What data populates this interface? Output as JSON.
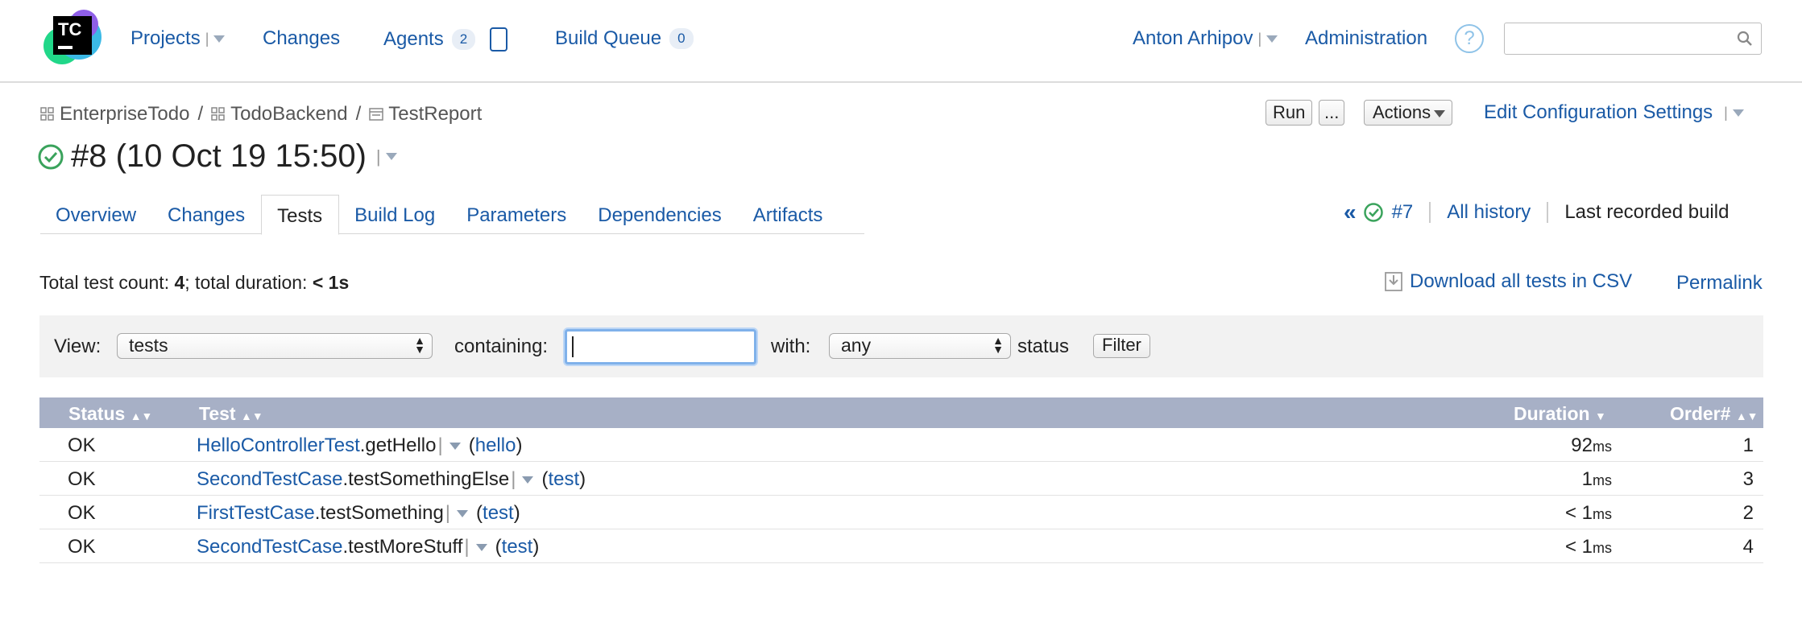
{
  "logo": {
    "text": "TC"
  },
  "nav": {
    "projects": "Projects",
    "changes": "Changes",
    "agents": "Agents",
    "agents_count": "2",
    "build_queue": "Build Queue",
    "build_queue_count": "0"
  },
  "user": {
    "name": "Anton Arhipov",
    "administration": "Administration",
    "help": "?"
  },
  "search": {
    "placeholder": ""
  },
  "breadcrumb": {
    "project": "EnterpriseTodo",
    "subproject": "TodoBackend",
    "config": "TestReport",
    "sep": "/"
  },
  "actions": {
    "run": "Run",
    "more": "...",
    "actions": "Actions",
    "edit": "Edit Configuration Settings"
  },
  "build": {
    "title": "#8 (10 Oct 19 15:50)"
  },
  "tabs": [
    {
      "label": "Overview"
    },
    {
      "label": "Changes"
    },
    {
      "label": "Tests"
    },
    {
      "label": "Build Log"
    },
    {
      "label": "Parameters"
    },
    {
      "label": "Dependencies"
    },
    {
      "label": "Artifacts"
    }
  ],
  "history": {
    "prev": "«",
    "prev_build": "#7",
    "all": "All history",
    "last": "Last recorded build"
  },
  "summary": {
    "prefix": "Total test count:",
    "count": "4",
    "mid": "; total duration:",
    "duration": "< 1s"
  },
  "links": {
    "csv": "Download all tests in CSV",
    "permalink": "Permalink"
  },
  "filter": {
    "view_label": "View:",
    "view_value": "tests",
    "containing_label": "containing:",
    "containing_value": "",
    "with_label": "with:",
    "with_value": "any",
    "status_label": "status",
    "button": "Filter"
  },
  "table": {
    "headers": {
      "status": "Status",
      "test": "Test",
      "duration": "Duration",
      "order": "Order#"
    },
    "rows": [
      {
        "status": "OK",
        "class": "HelloControllerTest",
        "method": ".getHello",
        "pkg": "hello",
        "duration": "92",
        "unit": "ms",
        "order": "1"
      },
      {
        "status": "OK",
        "class": "SecondTestCase",
        "method": ".testSomethingElse",
        "pkg": "test",
        "duration": "1",
        "unit": "ms",
        "order": "3"
      },
      {
        "status": "OK",
        "class": "FirstTestCase",
        "method": ".testSomething",
        "pkg": "test",
        "duration": "< 1",
        "unit": "ms",
        "order": "2"
      },
      {
        "status": "OK",
        "class": "SecondTestCase",
        "method": ".testMoreStuff",
        "pkg": "test",
        "duration": "< 1",
        "unit": "ms",
        "order": "4"
      }
    ]
  },
  "colors": {
    "link": "#1a5aa6",
    "header_bg": "#a7b0c6",
    "success": "#3aa35c"
  }
}
